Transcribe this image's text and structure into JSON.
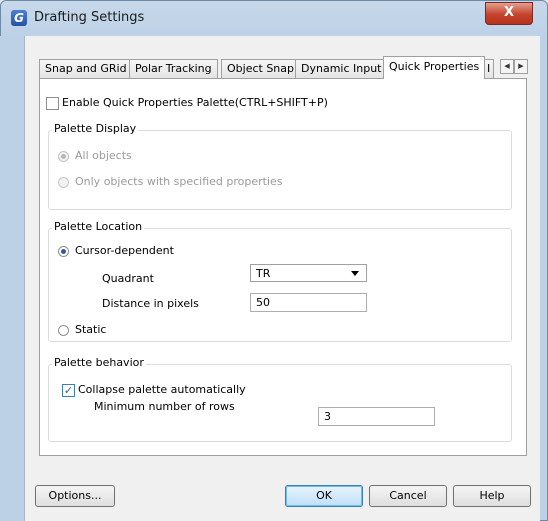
{
  "window": {
    "title": "Drafting Settings",
    "app_icon_letter": "G",
    "close_symbol": "X"
  },
  "tabs": [
    {
      "label": "Snap and GRid"
    },
    {
      "label": "Polar Tracking"
    },
    {
      "label": "Object Snap"
    },
    {
      "label": "Dynamic Input"
    },
    {
      "label": "Quick Properties",
      "active": true
    },
    {
      "label": "I"
    }
  ],
  "tab_scroll": {
    "left": "◀",
    "right": "▶"
  },
  "quick_properties": {
    "enable_label": "Enable Quick Properties Palette(CTRL+SHIFT+P)",
    "enable_checked": false,
    "palette_display": {
      "title": "Palette Display",
      "options": [
        "All objects",
        "Only objects with specified properties"
      ],
      "selected": "All objects"
    },
    "palette_location": {
      "title": "Palette Location",
      "cursor_dependent": "Cursor-dependent",
      "quadrant_label": "Quadrant",
      "quadrant_value": "TR",
      "distance_label": "Distance in pixels",
      "distance_value": "50",
      "static_label": "Static",
      "selected": "Cursor-dependent"
    },
    "palette_behavior": {
      "title": "Palette behavior",
      "collapse_label": "Collapse palette automatically",
      "collapse_checked": true,
      "min_rows_label": "Minimum number of rows",
      "min_rows_value": "3"
    }
  },
  "buttons": {
    "options": "Options...",
    "ok": "OK",
    "cancel": "Cancel",
    "help": "Help"
  },
  "colors": {
    "accent": "#2a5ea2",
    "close": "#c4432d"
  }
}
